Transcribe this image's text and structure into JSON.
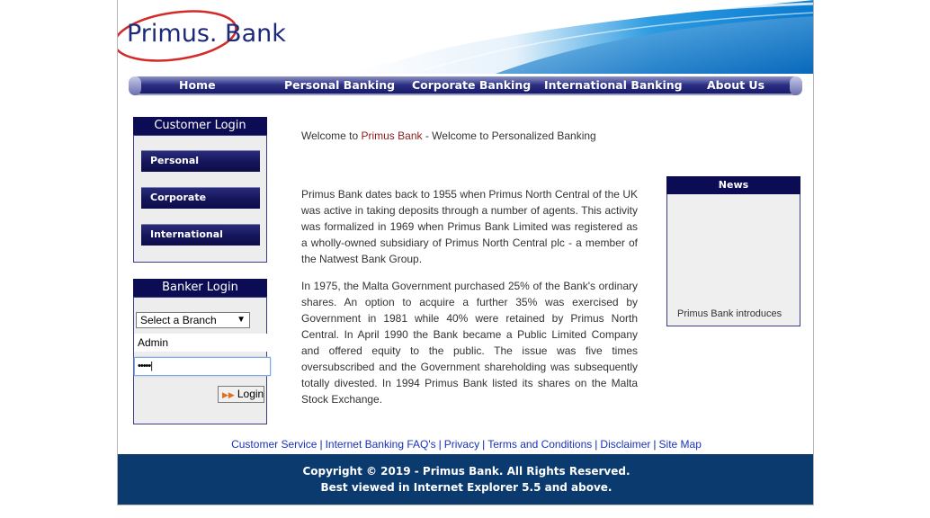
{
  "brand": {
    "logo_text": "Primus. Bank"
  },
  "nav": [
    "Home",
    "Personal Banking",
    "Corporate Banking",
    "International Banking",
    "About Us"
  ],
  "customer_login": {
    "title": "Customer Login",
    "buttons": [
      "Personal",
      "Corporate",
      "International"
    ]
  },
  "banker_login": {
    "title": "Banker Login",
    "branch_select": "Select a Branch",
    "username": "Admin",
    "password_mask": "•••••",
    "login_label": "Login"
  },
  "welcome": {
    "prefix": "Welcome to ",
    "brand": "Primus Bank",
    "suffix": " - Welcome to Personalized Banking"
  },
  "paragraphs": [
    "Primus Bank dates back to 1955 when Primus North Central of the UK was active in taking deposits through a number of agents. This activity was formalized in 1969 when Primus Bank Limited was registered as a wholly-owned subsidiary of Primus North Central plc - a member of the Natwest Bank Group.",
    "In 1975, the Malta Government purchased 25% of the Bank's ordinary shares. An option to acquire a further 35% was exercised by Government in 1981 while 40% were retained by Primus North Central. In April 1990 the Bank became a Public Limited Company and offered equity to the public. The issue was five times oversubscribed and the Government shareholding was subsequently totally divested. In 1994 Primus Bank listed its shares on the Malta Stock Exchange."
  ],
  "news": {
    "title": "News",
    "ticker": "Primus Bank introduces"
  },
  "footer_links": [
    "Customer Service",
    "Internet Banking FAQ's",
    "Privacy",
    "Terms and Conditions",
    "Disclaimer",
    "Site Map"
  ],
  "footer": {
    "copyright": "Copyright © 2019 - Primus Bank. All Rights Reserved.",
    "browser": "Best viewed in Internet Explorer 5.5 and above."
  },
  "colors": {
    "nav_dark": "#14165e",
    "box_title": "#0c0c55",
    "footer_bg": "#0b3a6e",
    "brand_red": "#8a1e1e"
  }
}
